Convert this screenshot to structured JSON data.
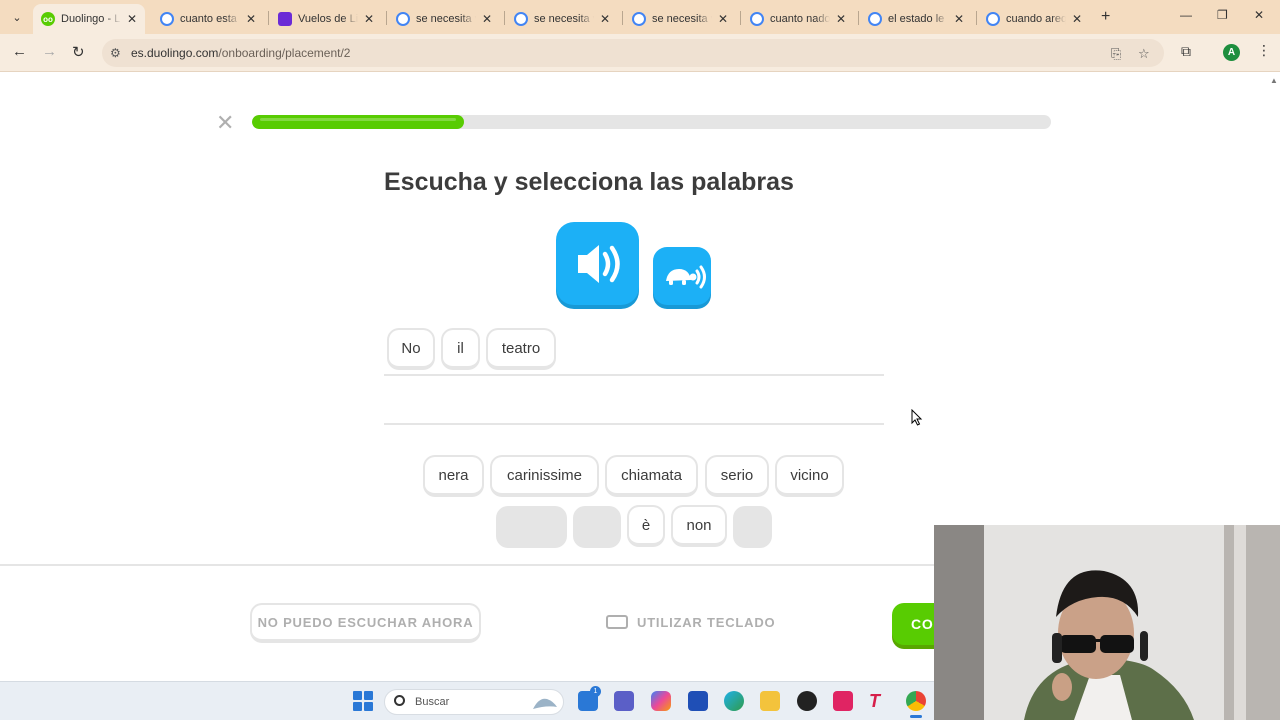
{
  "browser": {
    "tabs": [
      {
        "title": "Duolingo - Li",
        "favicon": "duolingo-icon",
        "active": true
      },
      {
        "title": "cuanto esta d",
        "favicon": "google-icon"
      },
      {
        "title": "Vuelos de Lin",
        "favicon": "flights-icon"
      },
      {
        "title": "se necesita vi",
        "favicon": "google-icon"
      },
      {
        "title": "se necesita vi",
        "favicon": "google-icon"
      },
      {
        "title": "se necesita vi",
        "favicon": "google-icon"
      },
      {
        "title": "cuanto nado",
        "favicon": "google-icon"
      },
      {
        "title": "el estado le d",
        "favicon": "google-icon"
      },
      {
        "title": "cuando areq",
        "favicon": "google-icon"
      }
    ],
    "url_host": "es.duolingo.com",
    "url_path": "/onboarding/placement/2",
    "profile_initial": "A"
  },
  "lesson": {
    "progress_fraction": 0.265,
    "heading": "Escucha y selecciona las palabras",
    "answer_words": [
      "No",
      "il",
      "teatro"
    ],
    "bank_row1": [
      "nera",
      "carinissime",
      "chiamata",
      "serio",
      "vicino"
    ],
    "bank_row2": [
      "",
      "",
      "è",
      "non",
      ""
    ],
    "cant_listen_label": "NO PUEDO ESCUCHAR AHORA",
    "keyboard_label": "UTILIZAR TECLADO",
    "continue_label": "CON"
  },
  "taskbar": {
    "search_placeholder": "Buscar",
    "badge_count": "1"
  },
  "colors": {
    "duolingo_green": "#58cc02",
    "duolingo_blue": "#1cb0f6",
    "tabstrip": "#f4dcc0"
  }
}
